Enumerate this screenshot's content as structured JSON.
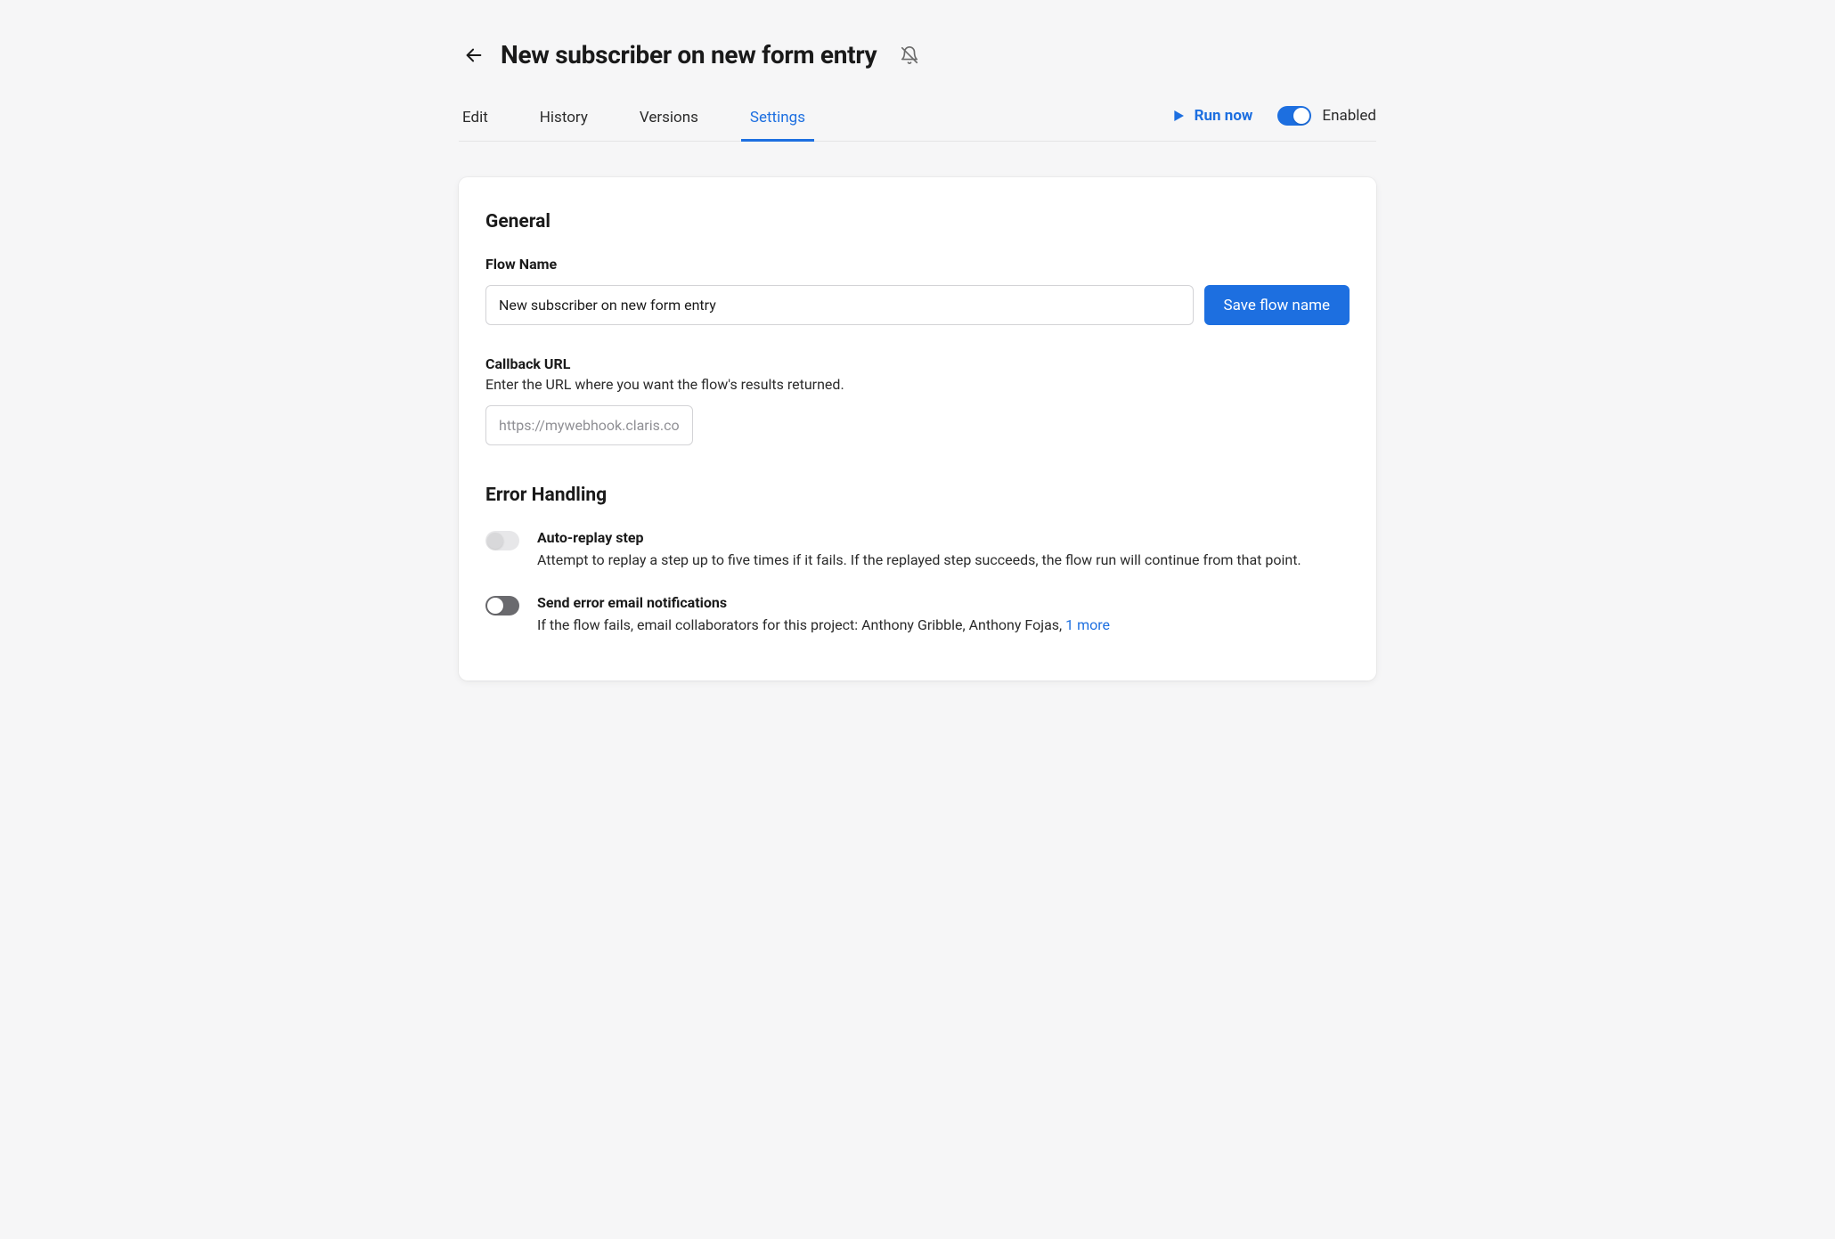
{
  "header": {
    "title": "New subscriber on new form entry"
  },
  "tabs": {
    "items": [
      {
        "label": "Edit"
      },
      {
        "label": "History"
      },
      {
        "label": "Versions"
      },
      {
        "label": "Settings"
      }
    ],
    "active_index": 3,
    "run_now_label": "Run now",
    "enabled_label": "Enabled",
    "enabled_state": true
  },
  "general": {
    "section_title": "General",
    "flow_name_label": "Flow Name",
    "flow_name_value": "New subscriber on new form entry",
    "save_flow_name_label": "Save flow name",
    "callback_label": "Callback URL",
    "callback_hint": "Enter the URL where you want the flow's results returned.",
    "callback_placeholder": "https://mywebhook.claris.connect.com",
    "callback_value": ""
  },
  "error_handling": {
    "section_title": "Error Handling",
    "auto_replay": {
      "title": "Auto-replay step",
      "desc": "Attempt to replay a step up to five times if it fails. If the replayed step succeeds, the flow run will continue from that point.",
      "state": false
    },
    "email_notify": {
      "title": "Send error email notifications",
      "desc_prefix": "If the flow fails, email collaborators for this project: Anthony Gribble, Anthony Fojas, ",
      "more_link": "1 more",
      "state": false
    }
  }
}
